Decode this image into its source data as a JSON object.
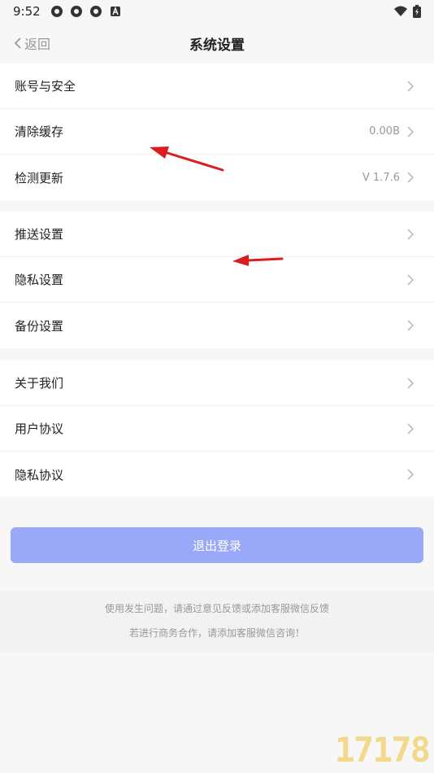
{
  "status_bar": {
    "time": "9:52",
    "icons": [
      "app-icon",
      "app-icon",
      "app-icon",
      "notification-a-icon",
      "wifi-icon",
      "battery-icon"
    ]
  },
  "nav": {
    "back_label": "返回",
    "title": "系统设置"
  },
  "groups": [
    [
      {
        "label": "账号与安全",
        "value": ""
      },
      {
        "label": "清除缓存",
        "value": "0.00B"
      },
      {
        "label": "检测更新",
        "value": "V 1.7.6"
      }
    ],
    [
      {
        "label": "推送设置",
        "value": ""
      },
      {
        "label": "隐私设置",
        "value": ""
      },
      {
        "label": "备份设置",
        "value": ""
      }
    ],
    [
      {
        "label": "关于我们",
        "value": ""
      },
      {
        "label": "用户协议",
        "value": ""
      },
      {
        "label": "隐私协议",
        "value": ""
      }
    ]
  ],
  "logout_label": "退出登录",
  "footer": {
    "line1": "使用发生问题，请通过意见反馈或添加客服微信反馈",
    "line2": "若进行商务合作，请添加客服微信咨询！"
  },
  "colors": {
    "accent": "#9aa9f7",
    "annotation_arrow": "#d81e1e"
  }
}
